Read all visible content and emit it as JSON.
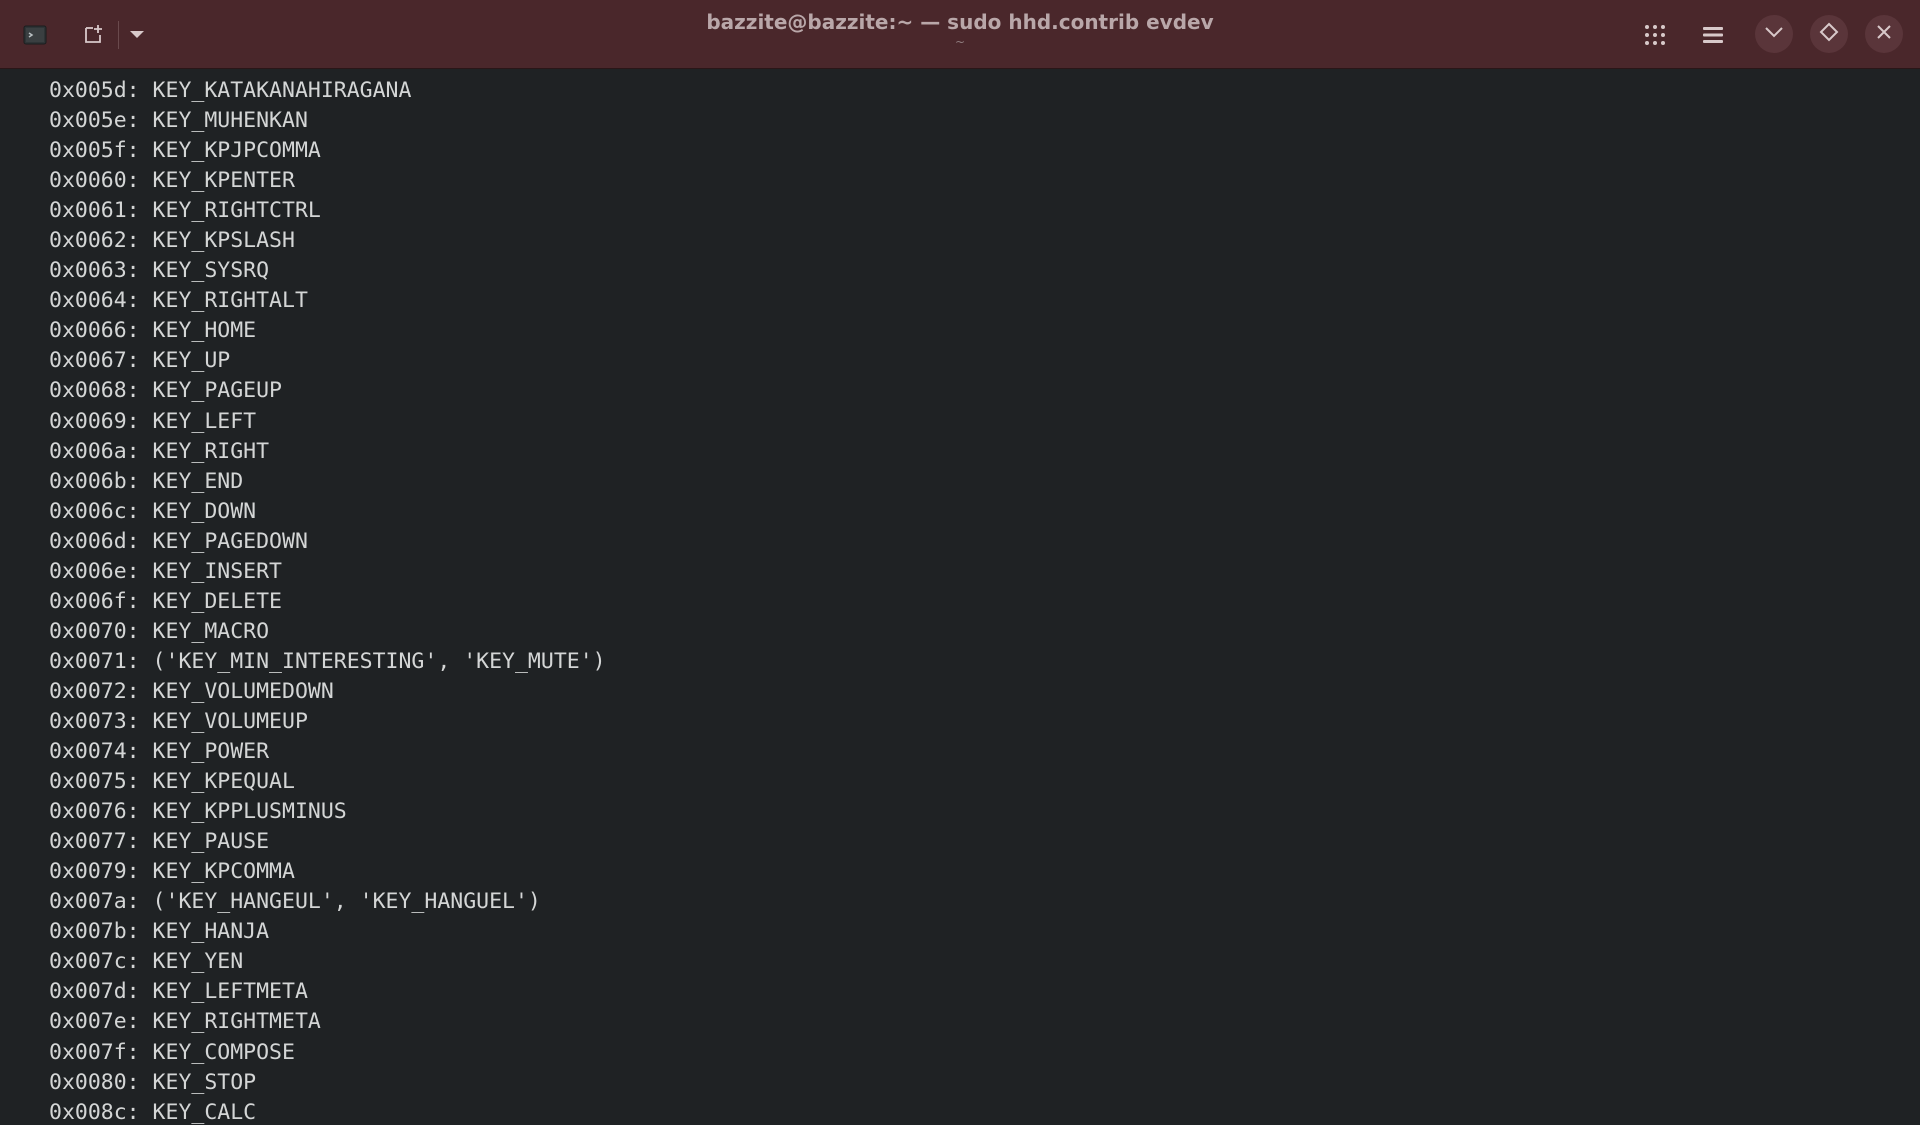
{
  "window": {
    "title": "bazzite@bazzite:~ — sudo hhd.contrib evdev",
    "subtitle": "~",
    "colors": {
      "titlebar": "#4a272b",
      "background": "#1f2224",
      "text": "#d4d6d6"
    },
    "icons": {
      "app": "terminal-icon",
      "new_tab": "new-tab-icon",
      "dropdown": "chevron-down-icon",
      "grid": "app-grid-icon",
      "menu": "hamburger-menu-icon",
      "minimize": "minimize-icon",
      "maximize": "maximize-icon",
      "close": "close-icon"
    }
  },
  "terminal": {
    "lines": [
      "0x005d: KEY_KATAKANAHIRAGANA",
      "0x005e: KEY_MUHENKAN",
      "0x005f: KEY_KPJPCOMMA",
      "0x0060: KEY_KPENTER",
      "0x0061: KEY_RIGHTCTRL",
      "0x0062: KEY_KPSLASH",
      "0x0063: KEY_SYSRQ",
      "0x0064: KEY_RIGHTALT",
      "0x0066: KEY_HOME",
      "0x0067: KEY_UP",
      "0x0068: KEY_PAGEUP",
      "0x0069: KEY_LEFT",
      "0x006a: KEY_RIGHT",
      "0x006b: KEY_END",
      "0x006c: KEY_DOWN",
      "0x006d: KEY_PAGEDOWN",
      "0x006e: KEY_INSERT",
      "0x006f: KEY_DELETE",
      "0x0070: KEY_MACRO",
      "0x0071: ('KEY_MIN_INTERESTING', 'KEY_MUTE')",
      "0x0072: KEY_VOLUMEDOWN",
      "0x0073: KEY_VOLUMEUP",
      "0x0074: KEY_POWER",
      "0x0075: KEY_KPEQUAL",
      "0x0076: KEY_KPPLUSMINUS",
      "0x0077: KEY_PAUSE",
      "0x0079: KEY_KPCOMMA",
      "0x007a: ('KEY_HANGEUL', 'KEY_HANGUEL')",
      "0x007b: KEY_HANJA",
      "0x007c: KEY_YEN",
      "0x007d: KEY_LEFTMETA",
      "0x007e: KEY_RIGHTMETA",
      "0x007f: KEY_COMPOSE",
      "0x0080: KEY_STOP",
      "0x008c: KEY_CALC"
    ]
  }
}
